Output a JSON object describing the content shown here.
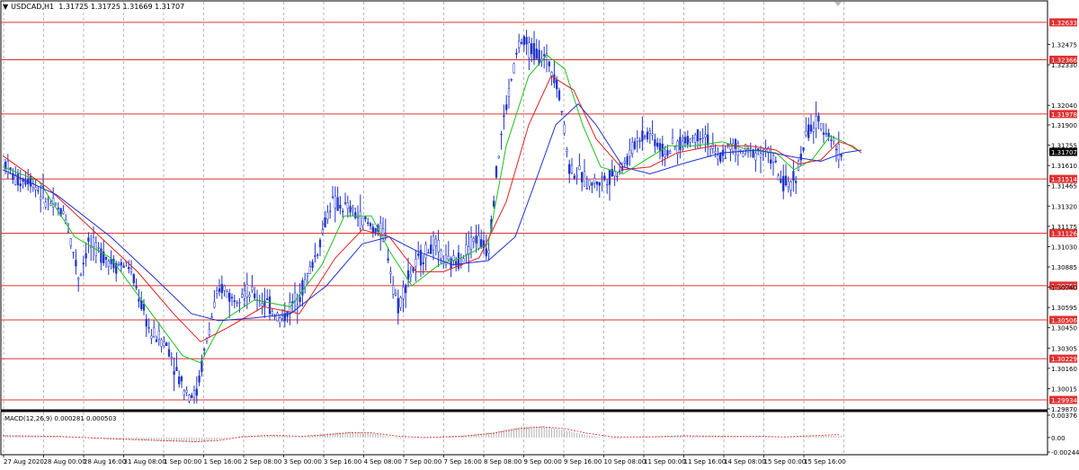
{
  "header": {
    "symbol": "USDCAD,H1",
    "ohlc": "1.31725 1.31725 1.31669 1.31707"
  },
  "macd_header": "MACD(12,26,9) 0.000281 0.000503",
  "current_price": "1.31707",
  "colors": {
    "candle": "#1f34c8",
    "level_line": "#e03030",
    "level_label_bg": "#e03030",
    "ma_fast": "#20c020",
    "ma_mid": "#e02020",
    "ma_slow": "#2030d0",
    "grid": "#888888",
    "macd_hist": "#b0b0b0",
    "macd_signal": "#e02020",
    "price_label_bg": "#000000"
  },
  "chart_data": {
    "type": "candlestick",
    "title": "USDCAD,H1",
    "ylim": [
      1.2987,
      1.3278
    ],
    "y_ticks": [
      "1.32475",
      "1.32330",
      "1.32040",
      "1.31900",
      "1.31755",
      "1.31610",
      "1.31465",
      "1.31320",
      "1.31175",
      "1.31030",
      "1.30885",
      "1.30740",
      "1.30595",
      "1.30450",
      "1.30305",
      "1.30160",
      "1.30015",
      "1.29870"
    ],
    "x_ticks": [
      "27 Aug 2020",
      "28 Aug 00:00",
      "28 Aug 16:00",
      "31 Aug 08:00",
      "1 Sep 00:00",
      "1 Sep 16:00",
      "2 Sep 08:00",
      "3 Sep 00:00",
      "3 Sep 16:00",
      "4 Sep 08:00",
      "7 Sep 00:00",
      "7 Sep 16:00",
      "8 Sep 08:00",
      "9 Sep 00:00",
      "9 Sep 16:00",
      "10 Sep 08:00",
      "11 Sep 00:00",
      "11 Sep 16:00",
      "14 Sep 08:00",
      "15 Sep 00:00",
      "15 Sep 16:00"
    ],
    "horizontal_levels": [
      "1.32633",
      "1.32366",
      "1.31978",
      "1.31514",
      "1.31126",
      "1.30751",
      "1.30506",
      "1.30229",
      "1.29934"
    ],
    "price_path": [
      [
        0,
        1.3166
      ],
      [
        15,
        1.315
      ],
      [
        30,
        1.3152
      ],
      [
        50,
        1.3135
      ],
      [
        70,
        1.3125
      ],
      [
        85,
        1.308
      ],
      [
        95,
        1.3105
      ],
      [
        110,
        1.3098
      ],
      [
        125,
        1.309
      ],
      [
        140,
        1.309
      ],
      [
        155,
        1.306
      ],
      [
        165,
        1.304
      ],
      [
        175,
        1.3038
      ],
      [
        185,
        1.303
      ],
      [
        195,
        1.301
      ],
      [
        205,
        1.3
      ],
      [
        215,
        1.2996
      ],
      [
        225,
        1.303
      ],
      [
        235,
        1.306
      ],
      [
        245,
        1.3075
      ],
      [
        255,
        1.3065
      ],
      [
        265,
        1.3072
      ],
      [
        280,
        1.3068
      ],
      [
        295,
        1.3062
      ],
      [
        310,
        1.305
      ],
      [
        320,
        1.306
      ],
      [
        335,
        1.3075
      ],
      [
        350,
        1.31
      ],
      [
        365,
        1.3135
      ],
      [
        375,
        1.3132
      ],
      [
        385,
        1.313
      ],
      [
        400,
        1.3122
      ],
      [
        415,
        1.3115
      ],
      [
        425,
        1.3112
      ],
      [
        433,
        1.308
      ],
      [
        440,
        1.306
      ],
      [
        450,
        1.308
      ],
      [
        465,
        1.3095
      ],
      [
        480,
        1.3105
      ],
      [
        495,
        1.309
      ],
      [
        510,
        1.3095
      ],
      [
        525,
        1.311
      ],
      [
        540,
        1.31
      ],
      [
        548,
        1.315
      ],
      [
        555,
        1.3185
      ],
      [
        565,
        1.322
      ],
      [
        575,
        1.325
      ],
      [
        585,
        1.3245
      ],
      [
        597,
        1.324
      ],
      [
        607,
        1.3235
      ],
      [
        615,
        1.3225
      ],
      [
        622,
        1.32
      ],
      [
        630,
        1.316
      ],
      [
        640,
        1.3155
      ],
      [
        652,
        1.3148
      ],
      [
        665,
        1.315
      ],
      [
        680,
        1.3155
      ],
      [
        695,
        1.3165
      ],
      [
        705,
        1.318
      ],
      [
        720,
        1.3185
      ],
      [
        735,
        1.317
      ],
      [
        750,
        1.3175
      ],
      [
        765,
        1.318
      ],
      [
        780,
        1.3185
      ],
      [
        795,
        1.3165
      ],
      [
        810,
        1.3175
      ],
      [
        825,
        1.317
      ],
      [
        840,
        1.3172
      ],
      [
        855,
        1.3168
      ],
      [
        865,
        1.315
      ],
      [
        875,
        1.3145
      ],
      [
        885,
        1.316
      ],
      [
        895,
        1.3185
      ],
      [
        905,
        1.319
      ],
      [
        915,
        1.3188
      ],
      [
        922,
        1.318
      ],
      [
        930,
        1.317
      ],
      [
        935,
        1.3171
      ]
    ],
    "series": [
      {
        "name": "MA fast",
        "values": [
          [
            0,
            1.316
          ],
          [
            40,
            1.315
          ],
          [
            80,
            1.311
          ],
          [
            120,
            1.3095
          ],
          [
            160,
            1.306
          ],
          [
            200,
            1.3025
          ],
          [
            220,
            1.302
          ],
          [
            245,
            1.305
          ],
          [
            280,
            1.3065
          ],
          [
            320,
            1.306
          ],
          [
            355,
            1.309
          ],
          [
            380,
            1.3125
          ],
          [
            410,
            1.3125
          ],
          [
            430,
            1.31
          ],
          [
            455,
            1.3075
          ],
          [
            485,
            1.309
          ],
          [
            510,
            1.3095
          ],
          [
            540,
            1.3105
          ],
          [
            560,
            1.3175
          ],
          [
            585,
            1.3225
          ],
          [
            605,
            1.324
          ],
          [
            625,
            1.323
          ],
          [
            645,
            1.319
          ],
          [
            665,
            1.316
          ],
          [
            690,
            1.3155
          ],
          [
            715,
            1.3165
          ],
          [
            740,
            1.3175
          ],
          [
            770,
            1.3175
          ],
          [
            800,
            1.3178
          ],
          [
            830,
            1.3172
          ],
          [
            860,
            1.317
          ],
          [
            880,
            1.3158
          ],
          [
            900,
            1.3165
          ],
          [
            920,
            1.3182
          ],
          [
            935,
            1.3178
          ],
          [
            950,
            1.3172
          ]
        ]
      },
      {
        "name": "MA mid",
        "values": [
          [
            0,
            1.3168
          ],
          [
            50,
            1.3145
          ],
          [
            100,
            1.3115
          ],
          [
            150,
            1.3085
          ],
          [
            190,
            1.3055
          ],
          [
            220,
            1.3035
          ],
          [
            250,
            1.3045
          ],
          [
            290,
            1.306
          ],
          [
            330,
            1.3055
          ],
          [
            370,
            1.3095
          ],
          [
            400,
            1.3115
          ],
          [
            430,
            1.311
          ],
          [
            460,
            1.3085
          ],
          [
            490,
            1.3085
          ],
          [
            530,
            1.3095
          ],
          [
            560,
            1.3135
          ],
          [
            585,
            1.319
          ],
          [
            610,
            1.3225
          ],
          [
            635,
            1.3215
          ],
          [
            660,
            1.318
          ],
          [
            690,
            1.3158
          ],
          [
            720,
            1.316
          ],
          [
            750,
            1.317
          ],
          [
            790,
            1.3175
          ],
          [
            830,
            1.3175
          ],
          [
            860,
            1.3172
          ],
          [
            885,
            1.3162
          ],
          [
            910,
            1.3165
          ],
          [
            930,
            1.3178
          ],
          [
            945,
            1.3175
          ],
          [
            955,
            1.317
          ]
        ]
      },
      {
        "name": "MA slow",
        "values": [
          [
            0,
            1.3158
          ],
          [
            60,
            1.314
          ],
          [
            120,
            1.311
          ],
          [
            170,
            1.308
          ],
          [
            210,
            1.3055
          ],
          [
            240,
            1.305
          ],
          [
            280,
            1.3052
          ],
          [
            320,
            1.3055
          ],
          [
            360,
            1.3075
          ],
          [
            400,
            1.3105
          ],
          [
            430,
            1.311
          ],
          [
            460,
            1.31
          ],
          [
            500,
            1.309
          ],
          [
            540,
            1.3093
          ],
          [
            570,
            1.311
          ],
          [
            590,
            1.3145
          ],
          [
            615,
            1.319
          ],
          [
            640,
            1.3205
          ],
          [
            660,
            1.319
          ],
          [
            690,
            1.316
          ],
          [
            720,
            1.3155
          ],
          [
            760,
            1.3163
          ],
          [
            800,
            1.317
          ],
          [
            840,
            1.3172
          ],
          [
            880,
            1.3167
          ],
          [
            910,
            1.3164
          ],
          [
            935,
            1.317
          ],
          [
            955,
            1.3172
          ]
        ]
      }
    ],
    "macd": {
      "ylim": [
        -0.00244,
        0.00376
      ],
      "y_ticks": [
        "0.00376",
        "0.00",
        "-0.00244"
      ],
      "histogram_profile": [
        [
          0,
          0.0004
        ],
        [
          60,
          0.0002
        ],
        [
          120,
          -0.0003
        ],
        [
          175,
          -0.0006
        ],
        [
          215,
          -0.0008
        ],
        [
          240,
          -0.0004
        ],
        [
          265,
          0.0002
        ],
        [
          300,
          0.0004
        ],
        [
          330,
          0.0001
        ],
        [
          355,
          0.0006
        ],
        [
          385,
          0.001
        ],
        [
          410,
          0.0008
        ],
        [
          440,
          -0.0002
        ],
        [
          470,
          0.0001
        ],
        [
          510,
          0.0003
        ],
        [
          545,
          0.0009
        ],
        [
          575,
          0.0018
        ],
        [
          600,
          0.0019
        ],
        [
          625,
          0.0012
        ],
        [
          650,
          0.0004
        ],
        [
          680,
          -0.0002
        ],
        [
          720,
          0.0002
        ],
        [
          760,
          0.0003
        ],
        [
          800,
          0.0002
        ],
        [
          840,
          0.0002
        ],
        [
          870,
          0.0
        ],
        [
          900,
          0.0003
        ],
        [
          930,
          0.00028
        ]
      ],
      "signal_profile": [
        [
          0,
          0.0003
        ],
        [
          60,
          0.0002
        ],
        [
          120,
          -0.0002
        ],
        [
          175,
          -0.0005
        ],
        [
          215,
          -0.0007
        ],
        [
          240,
          -0.0005
        ],
        [
          265,
          0.0001
        ],
        [
          300,
          0.0004
        ],
        [
          330,
          0.0002
        ],
        [
          355,
          0.0004
        ],
        [
          385,
          0.0008
        ],
        [
          410,
          0.0008
        ],
        [
          440,
          0.0002
        ],
        [
          470,
          0.0
        ],
        [
          510,
          0.0002
        ],
        [
          545,
          0.0007
        ],
        [
          575,
          0.0015
        ],
        [
          600,
          0.0018
        ],
        [
          625,
          0.0015
        ],
        [
          650,
          0.0007
        ],
        [
          680,
          0.0001
        ],
        [
          720,
          0.0001
        ],
        [
          760,
          0.0003
        ],
        [
          800,
          0.0002
        ],
        [
          840,
          0.0002
        ],
        [
          870,
          0.0001
        ],
        [
          900,
          0.0003
        ],
        [
          930,
          0.0005
        ]
      ]
    }
  }
}
